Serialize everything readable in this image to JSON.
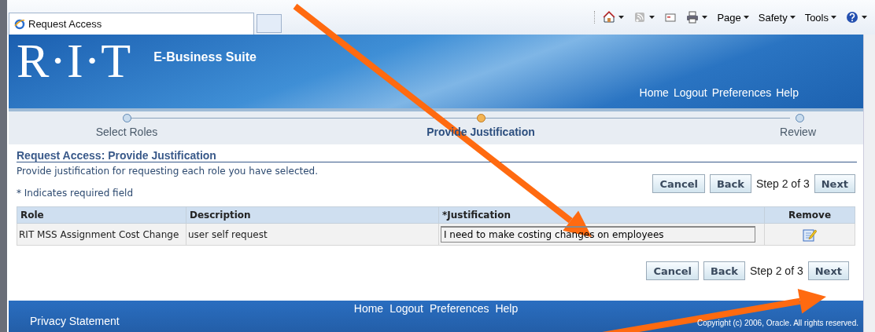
{
  "browser": {
    "tab": {
      "title": "Request Access",
      "selected": true
    },
    "toolbar": [
      {
        "kind": "home"
      },
      {
        "kind": "feeds"
      },
      {
        "kind": "mail"
      },
      {
        "kind": "print"
      },
      {
        "kind": "menu",
        "label": "Page"
      },
      {
        "kind": "menu",
        "label": "Safety"
      },
      {
        "kind": "menu",
        "label": "Tools"
      },
      {
        "kind": "help"
      }
    ]
  },
  "header": {
    "logo": "R·I·T",
    "app_name": "E-Business Suite",
    "links": [
      "Home",
      "Logout",
      "Preferences",
      "Help"
    ]
  },
  "train": [
    {
      "label": "Select Roles",
      "selected": false
    },
    {
      "label": "Provide Justification",
      "selected": true
    },
    {
      "label": "Review",
      "selected": false
    }
  ],
  "page": {
    "title": "Request Access: Provide Justification",
    "instruction": "Provide justification for requesting each role you have selected.",
    "required_note": "*  Indicates required field"
  },
  "nav_top": {
    "buttons": [
      "Cancel",
      "Back"
    ],
    "step": "Step 2 of 3",
    "next": "Next"
  },
  "table": {
    "columns": [
      "Role",
      "Description",
      "*Justification",
      "Remove"
    ],
    "rows": [
      {
        "role": "RIT MSS Assignment Cost Change",
        "description": "user self request",
        "justification": "I need to make costing changes on employees"
      }
    ]
  },
  "nav_bottom": {
    "buttons": [
      "Cancel",
      "Back"
    ],
    "step": "Step 2 of 3",
    "next": "Next"
  },
  "footer": {
    "links": [
      "Home",
      "Logout",
      "Preferences",
      "Help"
    ],
    "privacy": "Privacy Statement",
    "copyright": "Copyright (c) 2006, Oracle. All rights reserved."
  },
  "annotations": [
    {
      "kind": "arrow"
    },
    {
      "kind": "arrow"
    }
  ]
}
